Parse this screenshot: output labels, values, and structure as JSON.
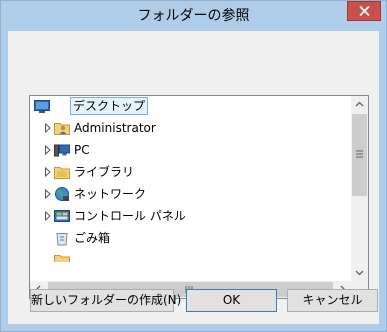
{
  "window": {
    "title": "フォルダーの参照"
  },
  "tree": {
    "items": [
      {
        "label": "デスクトップ",
        "icon": "desktop-icon",
        "selected": true
      },
      {
        "label": "Administrator",
        "icon": "user-folder-icon"
      },
      {
        "label": "PC",
        "icon": "computer-icon"
      },
      {
        "label": "ライブラリ",
        "icon": "library-folder-icon"
      },
      {
        "label": "ネットワーク",
        "icon": "network-icon"
      },
      {
        "label": "コントロール パネル",
        "icon": "control-panel-icon"
      },
      {
        "label": "ごみ箱",
        "icon": "recycle-bin-icon"
      }
    ]
  },
  "buttons": {
    "new_folder": "新しいフォルダーの作成(N)",
    "ok": "OK",
    "cancel": "キャンセル"
  },
  "colors": {
    "titlebar": "#afcde8",
    "close": "#c7504b",
    "selection": "#e5f3fb",
    "default_button_border": "#3c7fb1"
  }
}
